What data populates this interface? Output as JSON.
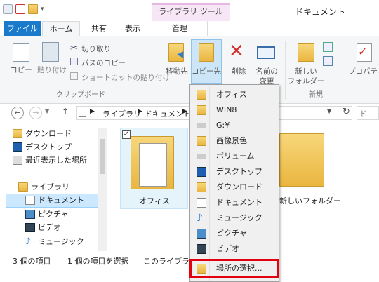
{
  "window": {
    "title": "ドキュメント",
    "context_tab": "ライブラリ ツール"
  },
  "tabs": {
    "file": "ファイル",
    "home": "ホーム",
    "share": "共有",
    "view": "表示",
    "manage": "管理"
  },
  "ribbon": {
    "copy": "コピー",
    "paste": "貼り付け",
    "cut": "切り取り",
    "copy_path": "パスのコピー",
    "paste_shortcut": "ショートカットの貼り付け",
    "clipboard_group": "クリップボード",
    "move_to": "移動先",
    "copy_to": "コピー先",
    "delete": "削除",
    "rename_1": "名前の",
    "rename_2": "変更",
    "new_folder_1": "新しい",
    "new_folder_2": "フォルダー",
    "new_group": "新規",
    "properties": "プロパティ"
  },
  "nav": {
    "back": "←",
    "forward": "→",
    "up": "↑",
    "breadcrumb_1": "ライブラリ",
    "breadcrumb_2": "ドキュメント",
    "search_placeholder": "ド"
  },
  "tree": [
    "ダウンロード",
    "デスクトップ",
    "最近表示した場所",
    "ライブラリ",
    "ドキュメント",
    "ピクチャ",
    "ビデオ",
    "ミュージック"
  ],
  "main": {
    "item_office": "オフィス",
    "item_newfolder": "新しいフォルダー"
  },
  "status": {
    "count": "3 個の項目",
    "selected": "1 個の項目を選択",
    "library": "このライブラリ"
  },
  "menu": {
    "items": [
      "オフィス",
      "WIN8",
      "G:¥",
      "画像景色",
      "ボリューム",
      "デスクトップ",
      "ダウンロード",
      "ドキュメント",
      "ミュージック",
      "ピクチャ",
      "ビデオ",
      "場所の選択..."
    ]
  },
  "colors": {
    "file_tab": "#1979ca",
    "context_tab": "#f7e6f5",
    "highlight_border": "#e3000f",
    "selection": "#e5f3fb"
  }
}
